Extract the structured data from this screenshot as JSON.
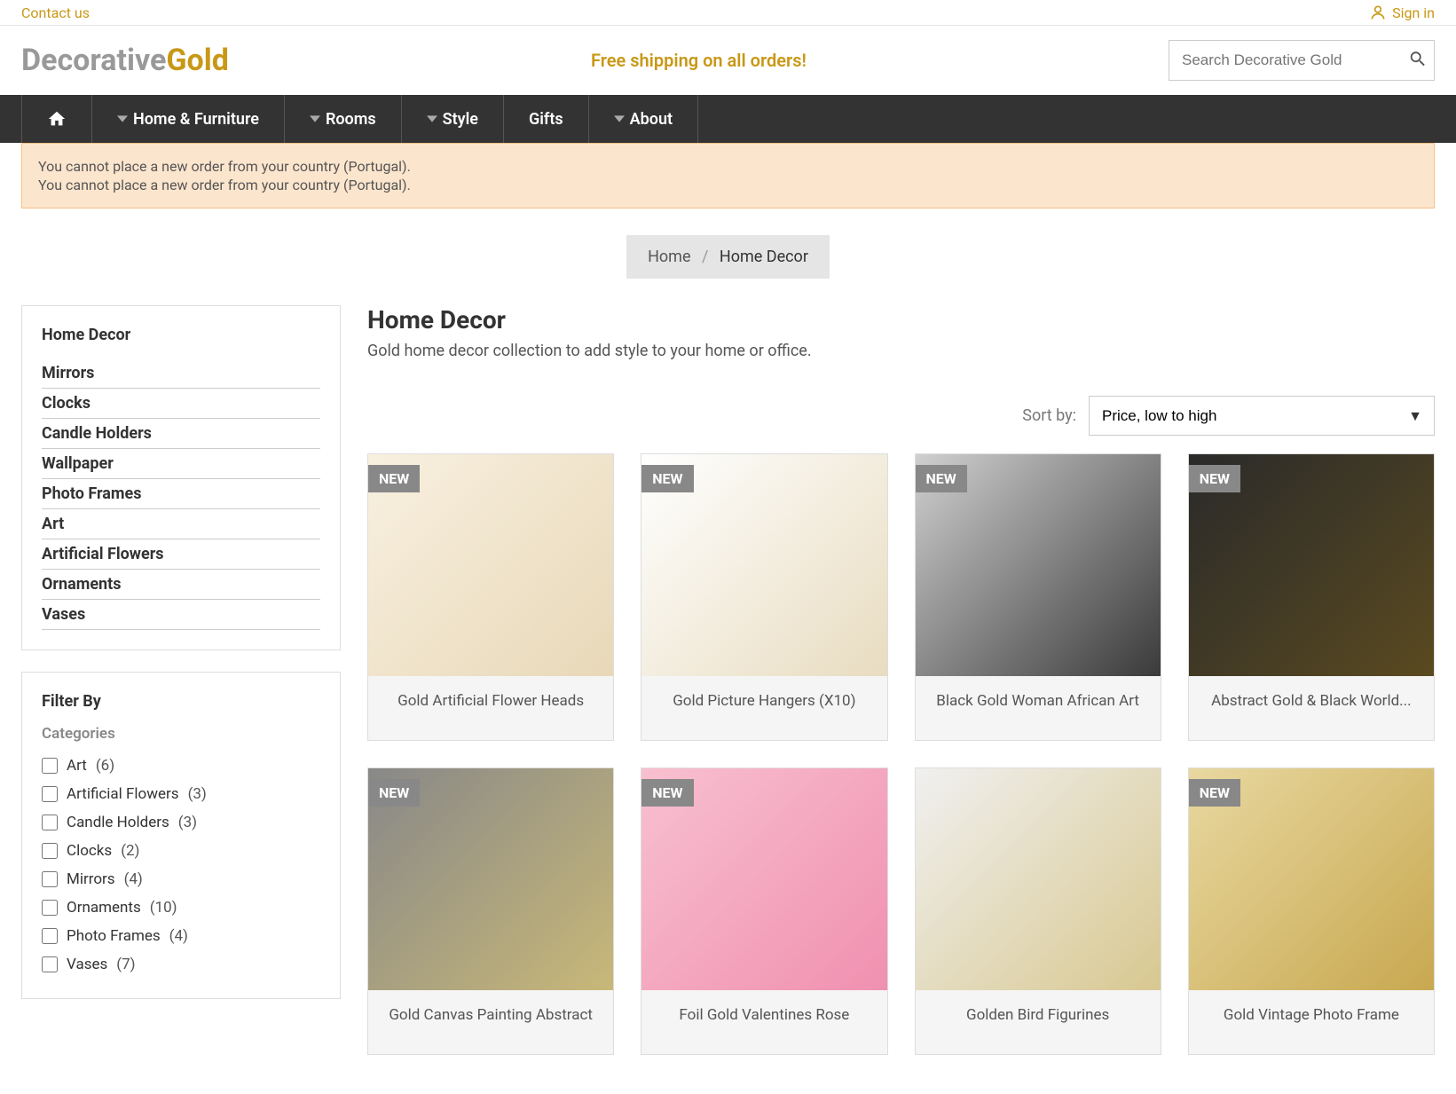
{
  "topbar": {
    "contact": "Contact us",
    "signin": "Sign in"
  },
  "logo": {
    "part1": "Decorative",
    "part2": "Gold"
  },
  "free_shipping": "Free shipping on all orders!",
  "search": {
    "placeholder": "Search Decorative Gold"
  },
  "nav": {
    "home_furniture": "Home & Furniture",
    "rooms": "Rooms",
    "style": "Style",
    "gifts": "Gifts",
    "about": "About"
  },
  "alerts": [
    "You cannot place a new order from your country (Portugal).",
    "You cannot place a new order from your country (Portugal)."
  ],
  "breadcrumb": {
    "home": "Home",
    "current": "Home Decor"
  },
  "sidebar": {
    "title": "Home Decor",
    "categories": [
      "Mirrors",
      "Clocks",
      "Candle Holders",
      "Wallpaper",
      "Photo Frames",
      "Art",
      "Artificial Flowers",
      "Ornaments",
      "Vases"
    ],
    "filter_title": "Filter By",
    "filter_sub": "Categories",
    "filters": [
      {
        "label": "Art",
        "count": "(6)"
      },
      {
        "label": "Artificial Flowers",
        "count": "(3)"
      },
      {
        "label": "Candle Holders",
        "count": "(3)"
      },
      {
        "label": "Clocks",
        "count": "(2)"
      },
      {
        "label": "Mirrors",
        "count": "(4)"
      },
      {
        "label": "Ornaments",
        "count": "(10)"
      },
      {
        "label": "Photo Frames",
        "count": "(4)"
      },
      {
        "label": "Vases",
        "count": "(7)"
      }
    ]
  },
  "page": {
    "title": "Home Decor",
    "desc": "Gold home decor collection to add style to your home or office."
  },
  "sort": {
    "label": "Sort by:",
    "value": "Price, low to high"
  },
  "badge_new": "NEW",
  "products": [
    {
      "title": "Gold Artificial Flower Heads",
      "new": true,
      "bg": "bg1"
    },
    {
      "title": "Gold Picture Hangers (X10)",
      "new": true,
      "bg": "bg2"
    },
    {
      "title": "Black Gold Woman African Art",
      "new": true,
      "bg": "bg3"
    },
    {
      "title": "Abstract Gold & Black World...",
      "new": true,
      "bg": "bg4"
    },
    {
      "title": "Gold Canvas Painting Abstract",
      "new": true,
      "bg": "bg5"
    },
    {
      "title": "Foil Gold Valentines Rose",
      "new": true,
      "bg": "bg6"
    },
    {
      "title": "Golden Bird Figurines",
      "new": false,
      "bg": "bg7"
    },
    {
      "title": "Gold Vintage Photo Frame",
      "new": true,
      "bg": "bg8"
    }
  ]
}
